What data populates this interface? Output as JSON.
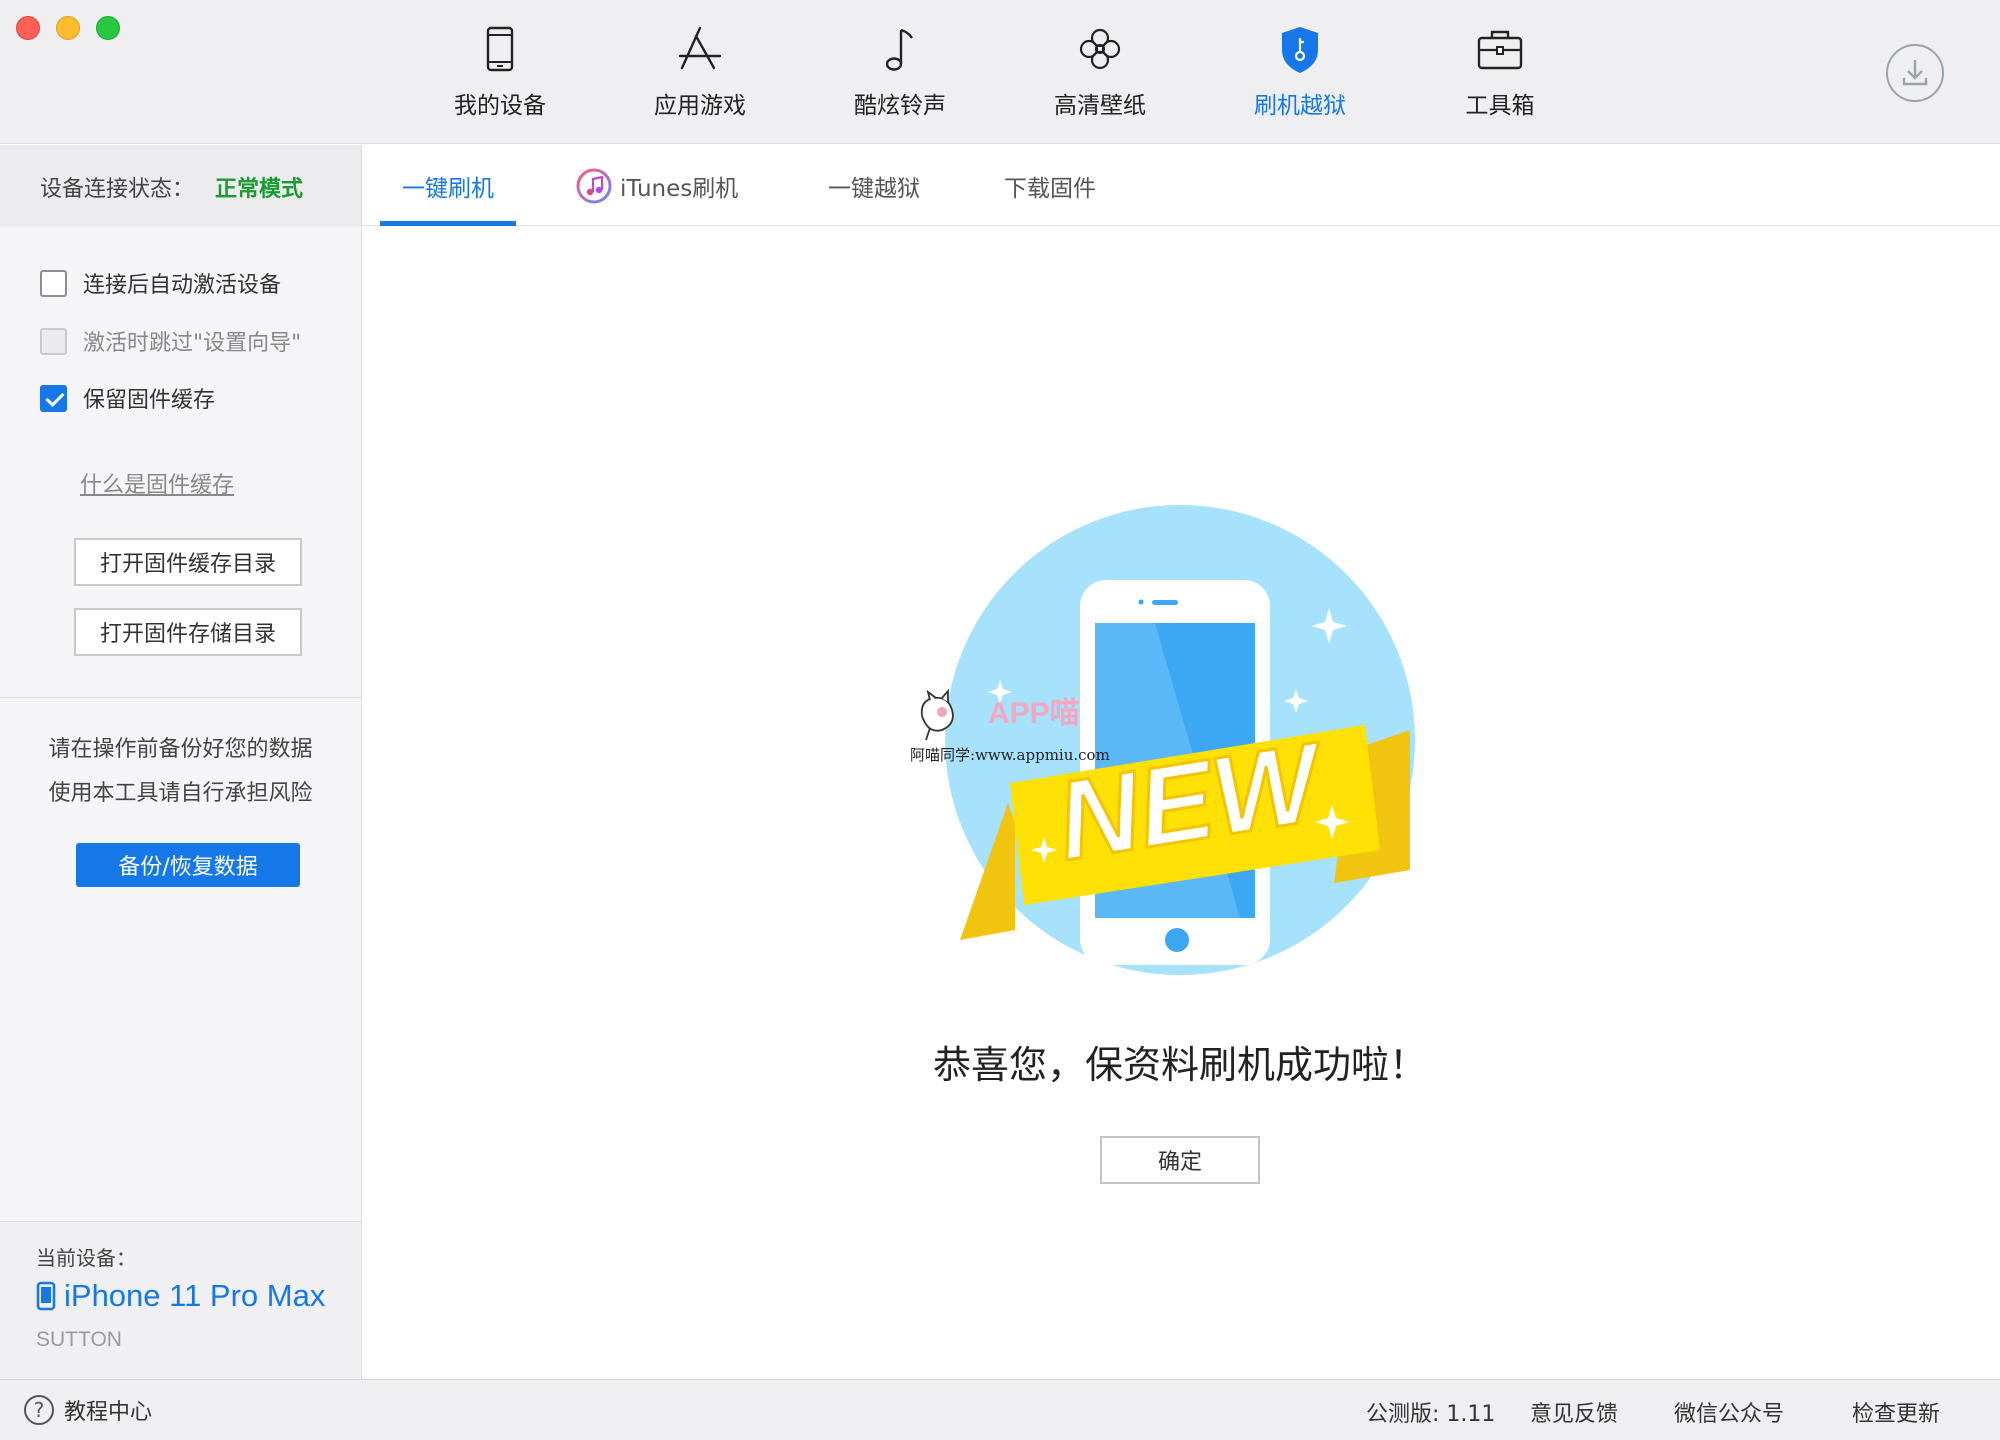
{
  "nav": {
    "items": [
      {
        "label": "我的设备",
        "icon": "phone-icon"
      },
      {
        "label": "应用游戏",
        "icon": "app-store-icon"
      },
      {
        "label": "酷炫铃声",
        "icon": "music-note-icon"
      },
      {
        "label": "高清壁纸",
        "icon": "flower-icon"
      },
      {
        "label": "刷机越狱",
        "icon": "shield-key-icon"
      },
      {
        "label": "工具箱",
        "icon": "toolbox-icon"
      }
    ],
    "active_index": 4,
    "active_color": "#1677e8"
  },
  "sidebar": {
    "status_label": "设备连接状态：",
    "status_value": "正常模式",
    "status_color": "#1a9b2f",
    "options": [
      {
        "label": "连接后自动激活设备",
        "checked": false,
        "disabled": false
      },
      {
        "label": "激活时跳过\"设置向导\"",
        "checked": false,
        "disabled": true
      },
      {
        "label": "保留固件缓存",
        "checked": true,
        "disabled": false
      }
    ],
    "cache_help_link": "什么是固件缓存",
    "open_cache_dir": "打开固件缓存目录",
    "open_storage_dir": "打开固件存储目录",
    "warning_line1": "请在操作前备份好您的数据",
    "warning_line2": "使用本工具请自行承担风险",
    "backup_button": "备份/恢复数据",
    "device_label": "当前设备：",
    "device_name": "iPhone 11 Pro Max",
    "device_owner": "SUTTON"
  },
  "tabs": [
    {
      "label": "一键刷机",
      "active": true
    },
    {
      "label": "iTunes刷机",
      "active": false
    },
    {
      "label": "一键越狱",
      "active": false
    },
    {
      "label": "下载固件",
      "active": false
    }
  ],
  "main": {
    "illustration_text": "NEW",
    "watermark_title": "APP喵",
    "watermark_sub": "阿喵同学:www.appmiu.com",
    "success_message": "恭喜您，保资料刷机成功啦！",
    "confirm_button": "确定"
  },
  "footer": {
    "help": "教程中心",
    "version": "公测版: 1.11",
    "feedback": "意见反馈",
    "wechat": "微信公众号",
    "update": "检查更新"
  }
}
